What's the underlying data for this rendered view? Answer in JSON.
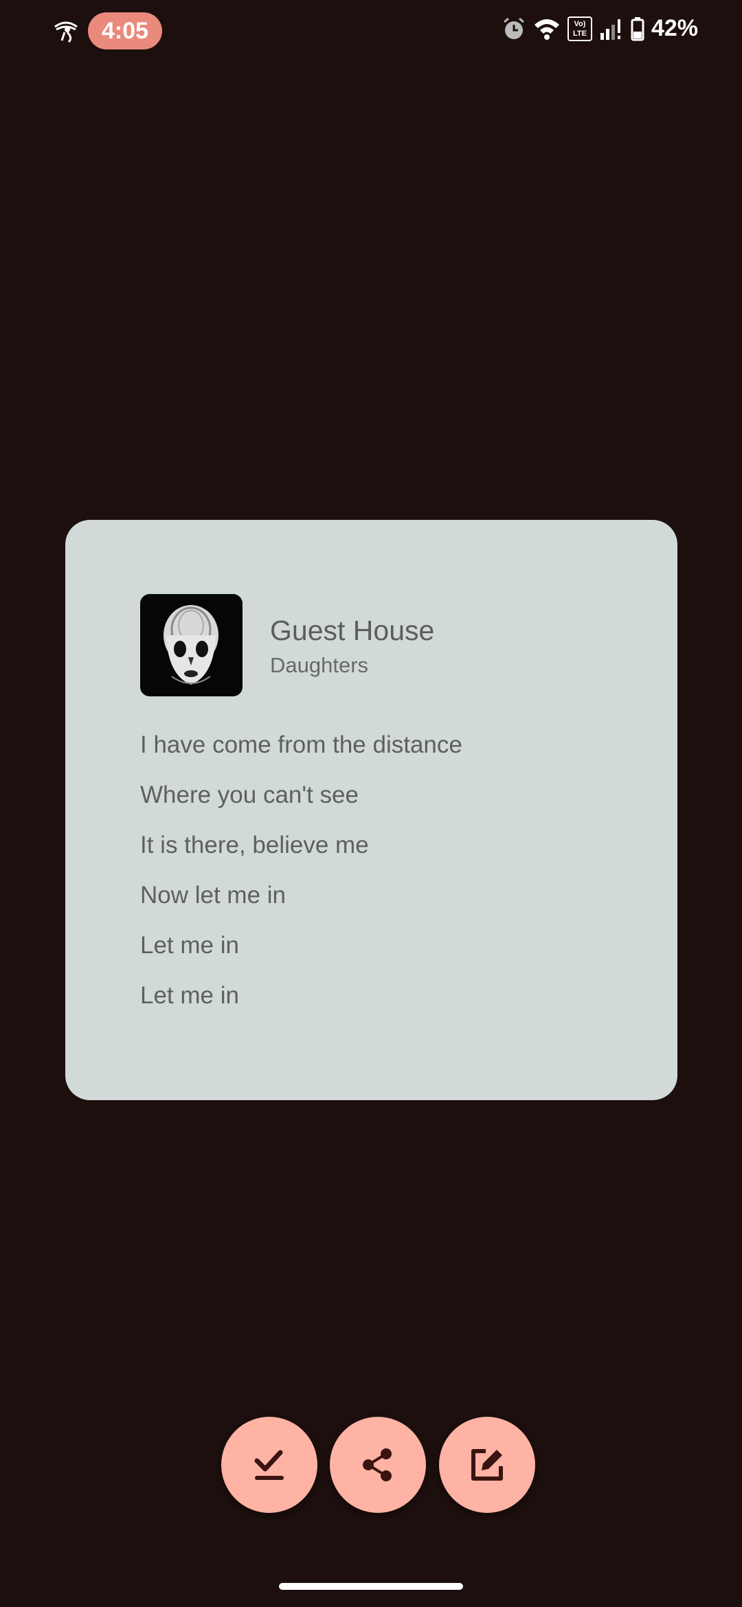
{
  "status_bar": {
    "time": "4:05",
    "battery": "42%",
    "volte_top": "Vo)",
    "volte_bottom": "LTE",
    "icons": [
      "eye-icon",
      "alarm-icon",
      "wifi-icon",
      "volte-icon",
      "signal-icon",
      "battery-icon"
    ]
  },
  "card": {
    "title": "Guest House",
    "artist": "Daughters",
    "lyrics": [
      "I have come from the distance",
      "Where you can't see",
      "It is there, believe me",
      "Now let me in",
      "Let me in",
      "Let me in"
    ],
    "background": "#d2dad9"
  },
  "actions": {
    "buttons": [
      "save-icon",
      "share-icon",
      "edit-icon"
    ],
    "fab_color": "#ffb3a4"
  },
  "theme": {
    "background": "#1c0f0d",
    "accent": "#e98a7d"
  }
}
